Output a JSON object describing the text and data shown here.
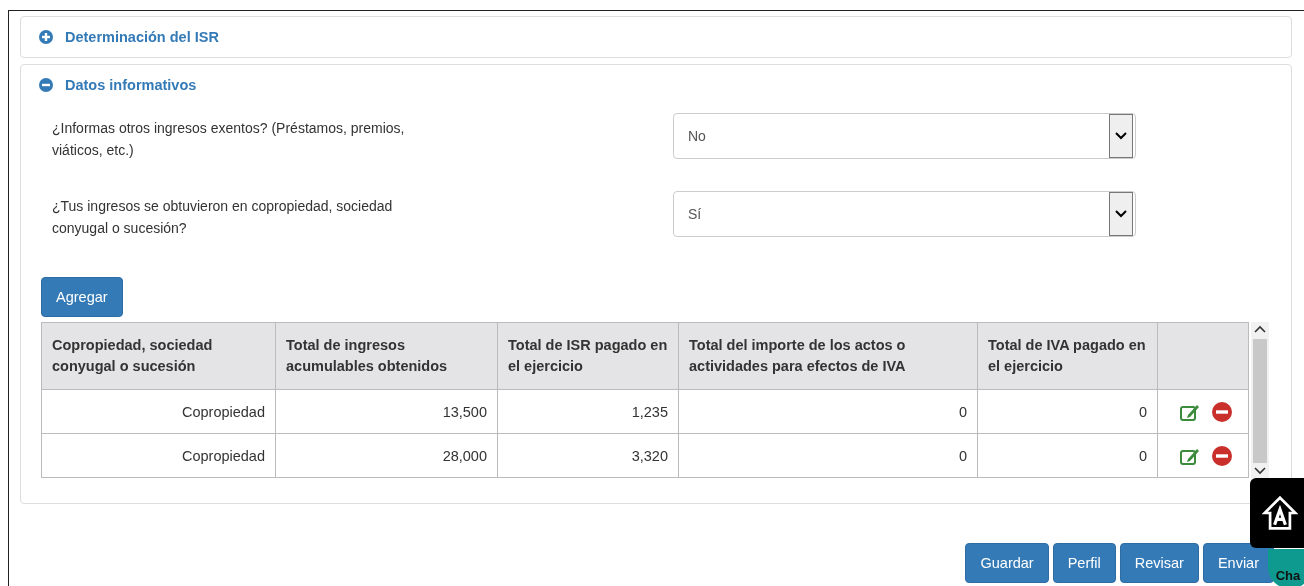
{
  "panels": [
    {
      "title": "Determinación del ISR",
      "expanded": false
    },
    {
      "title": "Datos informativos",
      "expanded": true
    }
  ],
  "questions": [
    {
      "label": "¿Informas otros ingresos exentos? (Préstamos, premios, viáticos, etc.)",
      "value": "No"
    },
    {
      "label": "¿Tus ingresos se obtuvieron en copropiedad, sociedad conyugal o sucesión?",
      "value": "Sí"
    }
  ],
  "add_button": "Agregar",
  "table": {
    "columns": [
      "Copropiedad, sociedad conyugal o sucesión",
      "Total de ingresos acumulables obtenidos",
      "Total de ISR pagado en el ejercicio",
      "Total del importe de los actos o actividades para efectos de IVA",
      "Total de IVA pagado en el ejercicio"
    ],
    "rows": [
      [
        "Copropiedad",
        "13,500",
        "1,235",
        "0",
        "0"
      ],
      [
        "Copropiedad",
        "28,000",
        "3,320",
        "0",
        "0"
      ]
    ]
  },
  "buttons": [
    "Guardar",
    "Perfil",
    "Revisar",
    "Enviar"
  ],
  "chat_label": "Cha"
}
